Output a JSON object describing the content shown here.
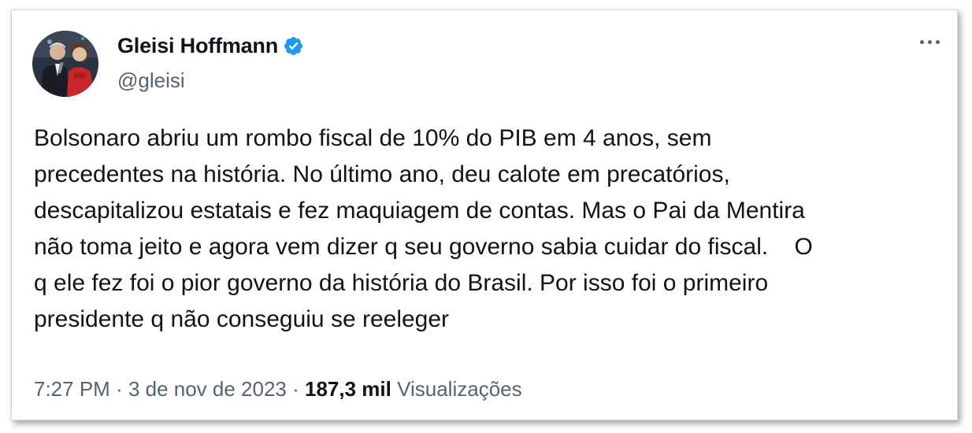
{
  "author": {
    "display_name": "Gleisi Hoffmann",
    "handle": "@gleisi",
    "verified_icon": "verified-badge-icon",
    "verified_color": "#1d9bf0",
    "avatar_icon": "profile-photo"
  },
  "menu": {
    "icon": "more-options-icon"
  },
  "tweet": {
    "text": "Bolsonaro abriu um rombo fiscal de 10% do PIB em 4 anos, sem\nprecedentes na história. No último ano, deu calote em precatórios,\ndescapitalizou estatais e fez maquiagem de contas. Mas o Pai da Mentira\nnão toma jeito e agora vem dizer q seu governo sabia cuidar do fiscal.    O\nq ele fez foi o pior governo da história do Brasil. Por isso foi o primeiro\npresidente q não conseguiu se reeleger"
  },
  "meta": {
    "time": "7:27 PM",
    "separator": " · ",
    "date": "3 de nov de 2023",
    "views_count": "187,3 mil",
    "views_label": "Visualizações"
  },
  "colors": {
    "text": "#0f1419",
    "secondary": "#536471",
    "border": "#cfd9de"
  }
}
